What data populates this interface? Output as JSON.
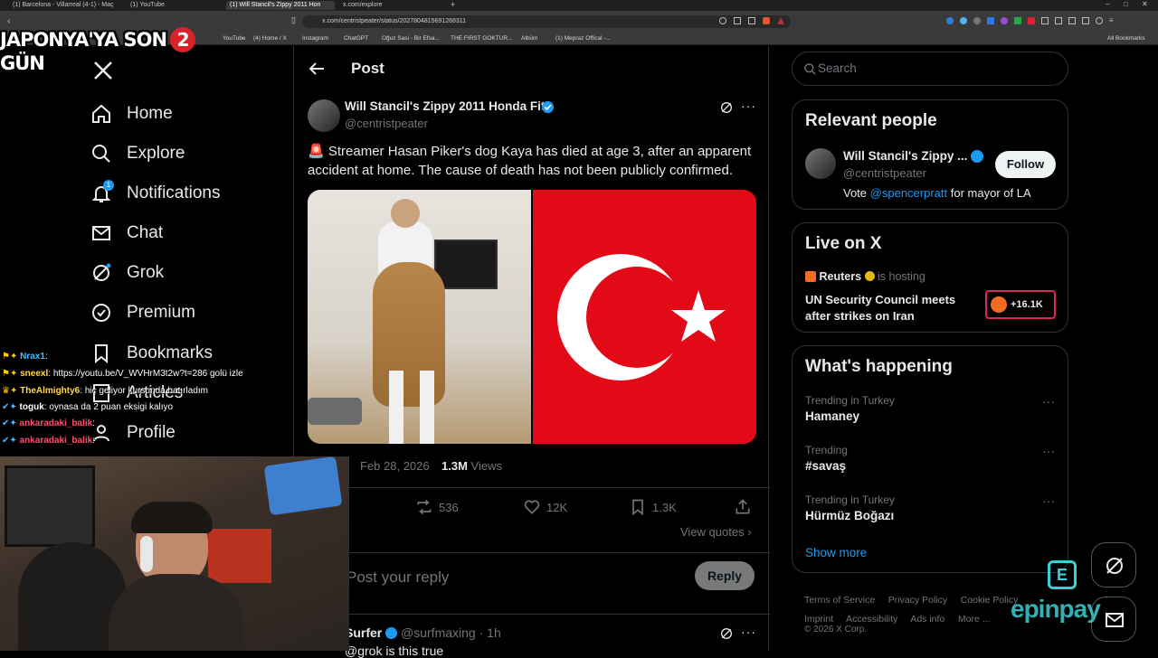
{
  "browser": {
    "tabs": [
      "(1) Barcelona - Villarreal (4-1) - Maç",
      "(1) YouTube",
      "(1) Will Stancil's Zippy 2011 Hon",
      "x.com/explore"
    ],
    "url": "x.com/centristpeater/status/2027804815691268311",
    "bookmarks": [
      "YouTube",
      "(4) Home / X",
      "Instagram",
      "ChatGPT",
      "Oğuz Sasi - Bir Efsa...",
      "THE FIRST GOKTUR...",
      "Albüm",
      "(1) Mepraz Offical -...",
      "All Bookmarks"
    ]
  },
  "overlay": {
    "banner_left": "JAPONYA'YA SON",
    "banner_num": "2",
    "banner_right": "GÜN",
    "chat": [
      {
        "user": "Nrax1",
        "msg": ""
      },
      {
        "user": "sneexl",
        "msg": "https://youtu.be/V_WVHrM3t2w?t=286 golü izle"
      },
      {
        "user": "TheAlmighty6",
        "msg": "hiç geliyor kursunda hatırladım"
      },
      {
        "user": "toguk",
        "msg": "oynasa da 2 puan eksigi kalıyo"
      },
      {
        "user": "ankaradaki_balik",
        "msg": ""
      },
      {
        "user": "ankaradaki_balik",
        "msg": ""
      }
    ],
    "sponsor": "epinpay"
  },
  "nav": {
    "home": "Home",
    "explore": "Explore",
    "notifications": "Notifications",
    "notif_count": "1",
    "chat": "Chat",
    "grok": "Grok",
    "premium": "Premium",
    "bookmarks": "Bookmarks",
    "articles": "Articles",
    "profile": "Profile"
  },
  "post": {
    "header": "Post",
    "author_name": "Will Stancil's Zippy 2011 Honda Fit",
    "author_handle": "@centristpeater",
    "text": "🚨 Streamer Hasan Piker's dog Kaya has died at age 3, after an apparent accident at home. The cause of death has not been publicly confirmed.",
    "date": "Feb 28, 2026",
    "views_count": "1.3M",
    "views_label": "Views",
    "reposts": "536",
    "likes": "12K",
    "bookmarks": "1.3K",
    "view_quotes": "View quotes",
    "reply_placeholder": "Post your reply",
    "reply_button": "Reply"
  },
  "reply": {
    "name": "Surfer",
    "handle": "@surfmaxing",
    "time": "1h",
    "text": "@grok is this true"
  },
  "right": {
    "search_placeholder": "Search",
    "relevant_title": "Relevant people",
    "person_name": "Will Stancil's Zippy ...",
    "person_handle": "@centristpeater",
    "follow": "Follow",
    "bio_prefix": "Vote",
    "bio_link": "@spencerpratt",
    "bio_suffix": "for mayor of LA",
    "live_title": "Live on X",
    "live_host": "Reuters",
    "live_hosting": "is hosting",
    "live_headline": "UN Security Council meets after strikes on Iran",
    "live_count": "+16.1K",
    "happening_title": "What's happening",
    "trends": [
      {
        "context": "Trending in Turkey",
        "name": "Hamaney"
      },
      {
        "context": "Trending",
        "name": "#savaş"
      },
      {
        "context": "Trending in Turkey",
        "name": "Hürmüz Boğazı"
      }
    ],
    "show_more": "Show more",
    "footer": [
      "Terms of Service",
      "Privacy Policy",
      "Cookie Policy",
      "Imprint",
      "Accessibility",
      "Ads info",
      "More ...",
      "© 2026 X Corp."
    ]
  },
  "colors": {
    "accent": "#1d9bf0",
    "background": "#000000",
    "border": "#2f3336",
    "muted": "#71767b",
    "flag_red": "#e30a17"
  }
}
